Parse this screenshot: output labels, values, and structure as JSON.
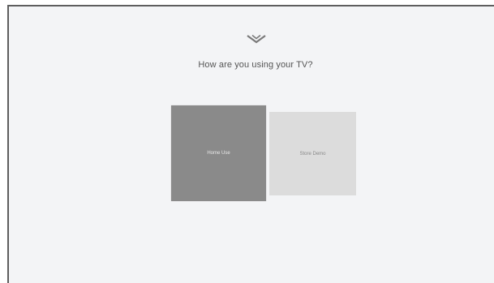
{
  "brand": {
    "icon": "vizio-v-chevron-icon",
    "color": "#7a7a7a"
  },
  "setup": {
    "question": "How are you using your TV?",
    "options": [
      {
        "label": "Home Use",
        "selected": true
      },
      {
        "label": "Store Demo",
        "selected": false
      }
    ]
  },
  "colors": {
    "background": "#f3f4f6",
    "selected_tile": "#8a8a8a",
    "unselected_tile": "#dcdcdc"
  }
}
